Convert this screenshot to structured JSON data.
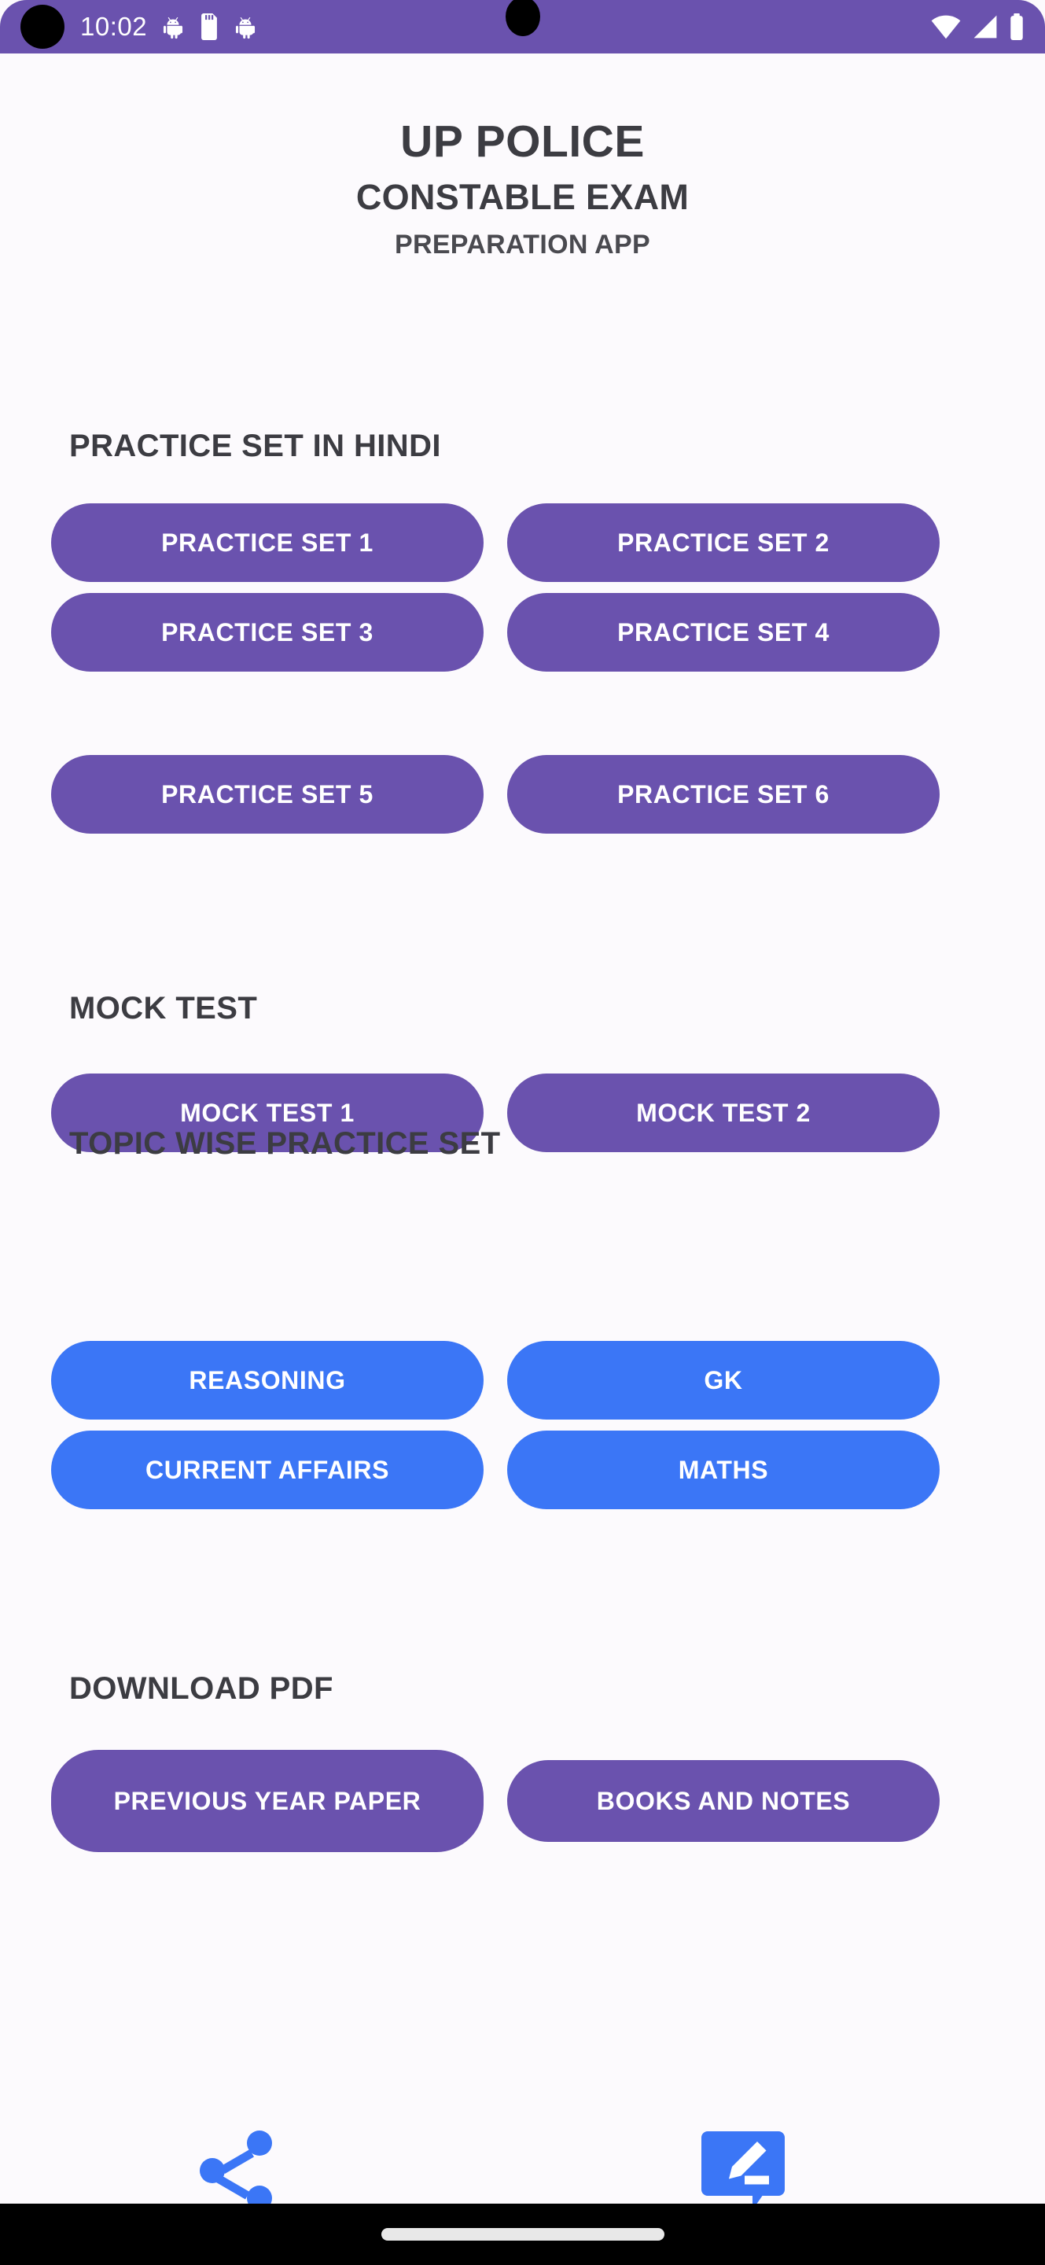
{
  "status_bar": {
    "time": "10:02",
    "left_icons": [
      "android-debug-icon",
      "sd-card-icon",
      "android-debug-icon"
    ],
    "right_icons": [
      "wifi-icon",
      "cellular-signal-icon",
      "battery-icon"
    ],
    "background_color": "#6A52AE"
  },
  "header": {
    "line1": "UP POLICE",
    "line2": "CONSTABLE EXAM",
    "line3": "PREPARATION APP"
  },
  "sections": [
    {
      "title": "PRACTICE SET IN HINDI",
      "color": "#6A52AE",
      "buttons": [
        "PRACTICE SET 1",
        "PRACTICE SET 2",
        "PRACTICE SET 3",
        "PRACTICE SET 4",
        "PRACTICE SET 5",
        "PRACTICE SET 6"
      ]
    },
    {
      "title": "MOCK TEST",
      "color": "#6A52AE",
      "buttons": [
        "MOCK TEST 1",
        "MOCK TEST 2"
      ]
    },
    {
      "title": "TOPIC WISE PRACTICE SET",
      "color": "#3B76F6",
      "buttons": [
        "REASONING",
        "GK",
        "CURRENT AFFAIRS",
        "MATHS"
      ]
    },
    {
      "title": "DOWNLOAD PDF",
      "color": "#6A52AE",
      "buttons": [
        "PREVIOUS YEAR PAPER",
        "BOOKS AND NOTES"
      ]
    }
  ],
  "bottom_bar": {
    "share_icon": "share-icon",
    "feedback_icon": "feedback-edit-icon",
    "icon_color": "#3B76F6"
  },
  "nav_bar": {
    "gesture_pill": "home-gesture-pill"
  }
}
